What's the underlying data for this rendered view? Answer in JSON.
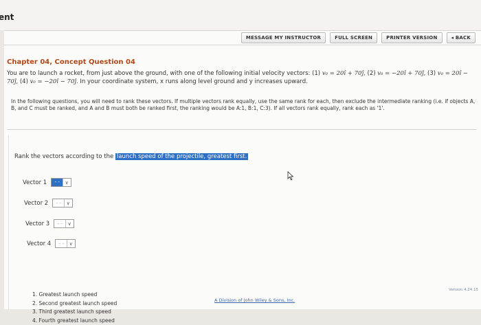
{
  "page_title_fragment": "ent",
  "toolbar": {
    "message_instructor": "MESSAGE MY INSTRUCTOR",
    "full_screen": "FULL SCREEN",
    "printer_version": "PRINTER VERSION",
    "back": "◂ BACK"
  },
  "question": {
    "title": "Chapter 04, Concept Question 04",
    "intro": "You are to launch a rocket, from just above the ground, with one of the following initial velocity vectors: (1)",
    "v1": "= 20î + 70ĵ,",
    "v2_label": "(2)",
    "v2": "= −20î + 70ĵ,",
    "v3_label": "(3)",
    "v3": "= 20î − 70ĵ,",
    "v4_label": "(4)",
    "v4": "= −20î − 70ĵ.",
    "coord_text": "In your coordinate system, x runs along level ground and y increases upward.",
    "vec_symbol": "v₀",
    "instructions": "In the following questions, you will need to rank these vectors. If multiple vectors rank equally, use the same rank for each, then exclude the intermediate ranking (i.e. if objects A, B, and C must be ranked, and A and B must both be ranked first, the ranking would be A:1, B:1, C:3). If all vectors rank equally, rank each as '1'."
  },
  "ranking": {
    "prompt": "Rank the vectors according to the",
    "highlight": "launch speed of the projectile, greatest first.",
    "rows": [
      {
        "label": "Vector 1",
        "value": "- -"
      },
      {
        "label": "Vector 2",
        "value": "- -"
      },
      {
        "label": "Vector 3",
        "value": "- -"
      },
      {
        "label": "Vector 4",
        "value": "- -"
      }
    ],
    "dropdown_arrow": "∨",
    "legend": [
      "1. Greatest launch speed",
      "2. Second greatest launch speed",
      "3. Third greatest launch speed",
      "4. Fourth greatest launch speed"
    ]
  },
  "footer": {
    "copyright": "A Division of John Wiley & Sons, Inc.",
    "version": "Version 4.24.15"
  }
}
